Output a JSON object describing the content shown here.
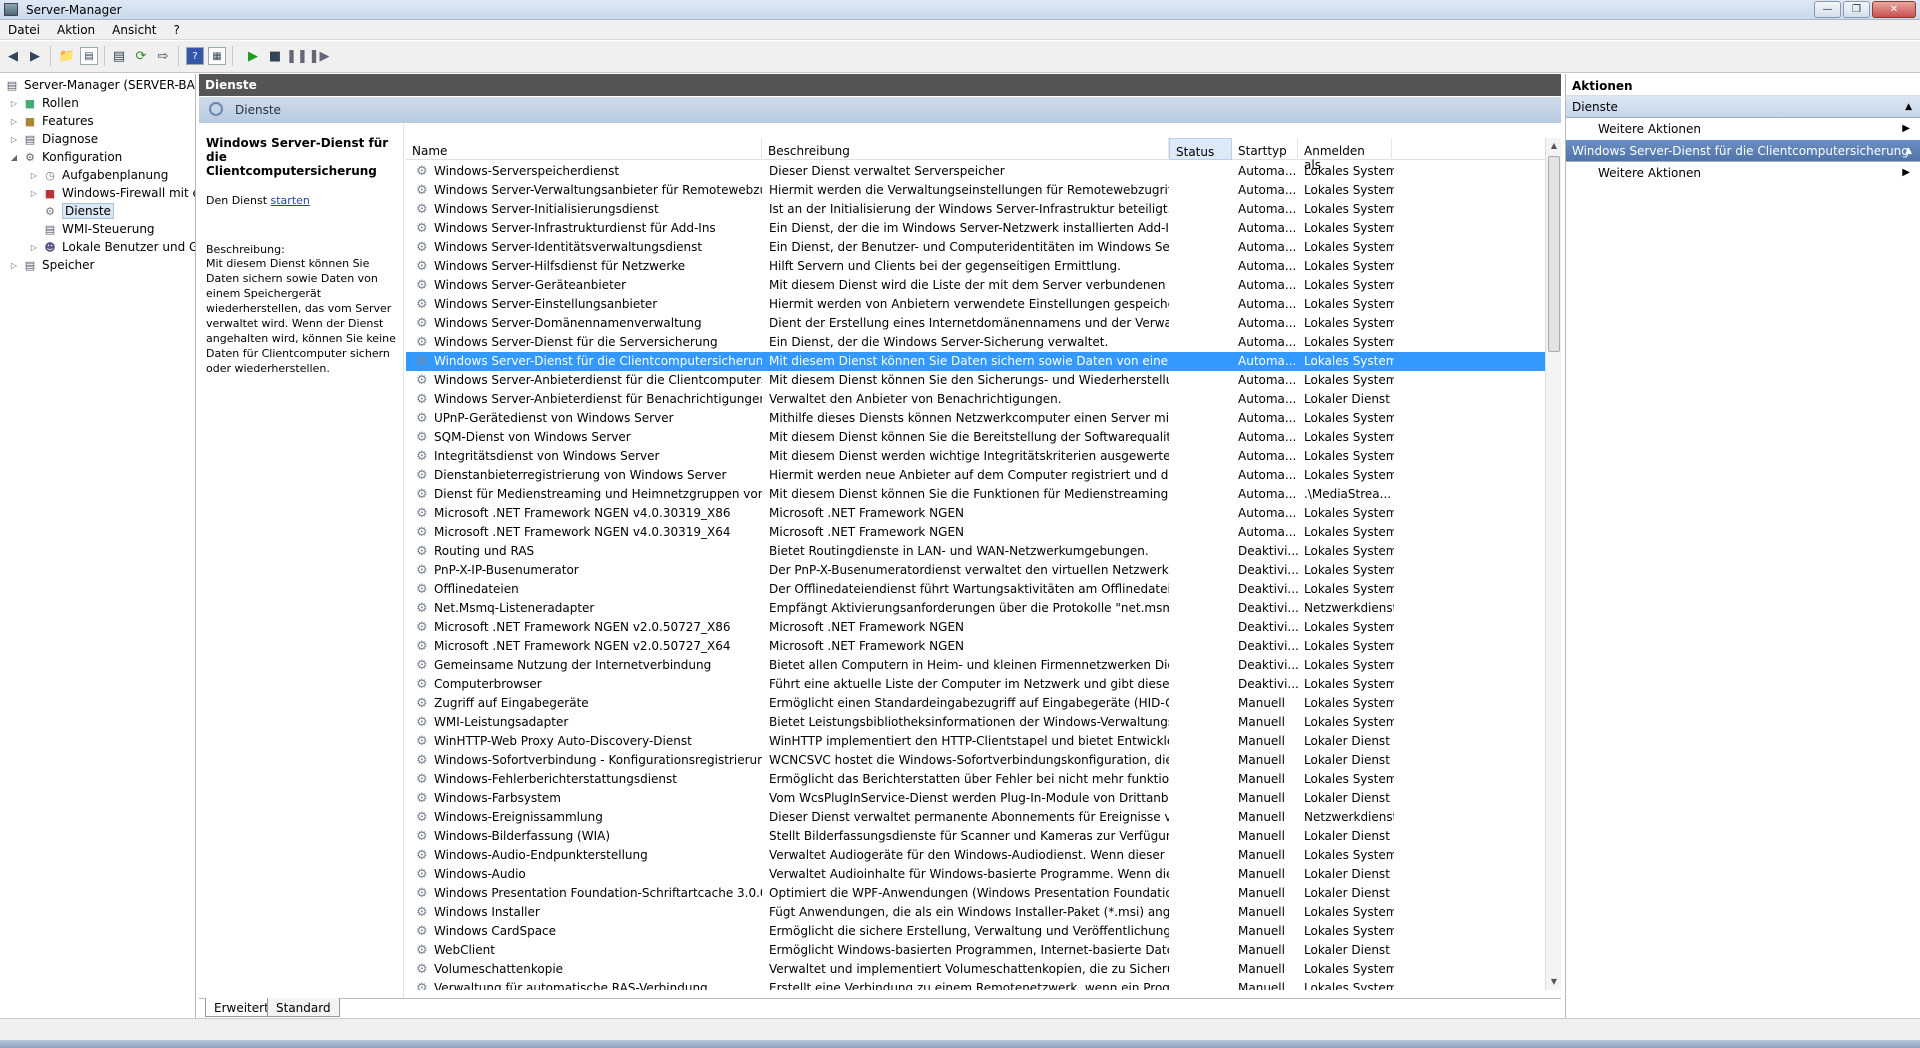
{
  "window": {
    "title": "Server-Manager"
  },
  "menu": [
    "Datei",
    "Aktion",
    "Ansicht",
    "?"
  ],
  "tree": {
    "items": [
      {
        "label": "Server-Manager (SERVER-BACKUP)",
        "level": 0,
        "expander": "",
        "icon": "server-icon"
      },
      {
        "label": "Rollen",
        "level": 1,
        "expander": "▷",
        "icon": "roles-icon"
      },
      {
        "label": "Features",
        "level": 1,
        "expander": "▷",
        "icon": "features-icon"
      },
      {
        "label": "Diagnose",
        "level": 1,
        "expander": "▷",
        "icon": "diagnostics-icon"
      },
      {
        "label": "Konfiguration",
        "level": 1,
        "expander": "◢",
        "icon": "configuration-icon"
      },
      {
        "label": "Aufgabenplanung",
        "level": 2,
        "expander": "▷",
        "icon": "clock-icon"
      },
      {
        "label": "Windows-Firewall mit erweiterter Sicherheit",
        "level": 2,
        "expander": "▷",
        "icon": "firewall-icon"
      },
      {
        "label": "Dienste",
        "level": 2,
        "expander": "",
        "icon": "services-icon",
        "selected": true
      },
      {
        "label": "WMI-Steuerung",
        "level": 2,
        "expander": "",
        "icon": "wmi-icon"
      },
      {
        "label": "Lokale Benutzer und Gruppen",
        "level": 2,
        "expander": "▷",
        "icon": "users-icon"
      },
      {
        "label": "Speicher",
        "level": 1,
        "expander": "▷",
        "icon": "storage-icon"
      }
    ]
  },
  "center": {
    "header": "Dienste",
    "search_label": "Dienste",
    "detail": {
      "service_title": "Windows Server-Dienst für die Clientcomputersicherung",
      "action_prefix": "Den Dienst",
      "action_link": "starten",
      "desc_label": "Beschreibung:",
      "desc_text": "Mit diesem Dienst können Sie Daten sichern sowie Daten von einem Speichergerät wiederherstellen, das vom Server verwaltet wird. Wenn der Dienst angehalten wird, können Sie keine Daten für Clientcomputer sichern oder wiederherstellen."
    },
    "columns": [
      "Name",
      "Beschreibung",
      "Status",
      "Starttyp",
      "Anmelden als"
    ],
    "rows": [
      [
        "Windows-Serverspeicherdienst",
        "Dieser Dienst verwaltet Serverspeicher",
        "",
        "Automa...",
        "Lokales System"
      ],
      [
        "Windows Server-Verwaltungsanbieter für Remotewebzugriff",
        "Hiermit werden die Verwaltungseinstellungen für Remotewebzugriff konfi...",
        "",
        "Automa...",
        "Lokales System"
      ],
      [
        "Windows Server-Initialisierungsdienst",
        "Ist an der Initialisierung der Windows Server-Infrastruktur beteiligt.",
        "",
        "Automa...",
        "Lokales System"
      ],
      [
        "Windows Server-Infrastrukturdienst für Add-Ins",
        "Ein Dienst, der die im Windows Server-Netzwerk installierten Add-Ins verw...",
        "",
        "Automa...",
        "Lokales System"
      ],
      [
        "Windows Server-Identitätsverwaltungsdienst",
        "Ein Dienst, der Benutzer- und Computeridentitäten im Windows Server-N...",
        "",
        "Automa...",
        "Lokales System"
      ],
      [
        "Windows Server-Hilfsdienst für Netzwerke",
        "Hilft Servern und Clients bei der gegenseitigen Ermittlung.",
        "",
        "Automa...",
        "Lokales System"
      ],
      [
        "Windows Server-Geräteanbieter",
        "Mit diesem Dienst wird die Liste der mit dem Server verbundenen Comput...",
        "",
        "Automa...",
        "Lokales System"
      ],
      [
        "Windows Server-Einstellungsanbieter",
        "Hiermit werden von Anbietern verwendete Einstellungen gespeichert.",
        "",
        "Automa...",
        "Lokales System"
      ],
      [
        "Windows Server-Domänennamenverwaltung",
        "Dient der Erstellung eines Internetdomänennamens und der Verwaltung d...",
        "",
        "Automa...",
        "Lokales System"
      ],
      [
        "Windows Server-Dienst für die Serversicherung",
        "Ein Dienst, der die Windows Server-Sicherung verwaltet.",
        "",
        "Automa...",
        "Lokales System"
      ],
      [
        "Windows Server-Dienst für die Clientcomputersicherung",
        "Mit diesem Dienst können Sie Daten sichern sowie Daten von einem Speic...",
        "",
        "Automa...",
        "Lokales System"
      ],
      [
        "Windows Server-Anbieterdienst für die Clientcomputersicher...",
        "Mit diesem Dienst können Sie den Sicherungs- und Wiederherstellungsdie...",
        "",
        "Automa...",
        "Lokales System"
      ],
      [
        "Windows Server-Anbieterdienst für Benachrichtigungen",
        "Verwaltet den Anbieter von Benachrichtigungen.",
        "",
        "Automa...",
        "Lokaler Dienst"
      ],
      [
        "UPnP-Gerätedienst von Windows Server",
        "Mithilfe dieses Diensts können Netzwerkcomputer einen Server mit Windo...",
        "",
        "Automa...",
        "Lokales System"
      ],
      [
        "SQM-Dienst von Windows Server",
        "Mit diesem Dienst können Sie die Bereitstellung der Softwarequalitätsmetr...",
        "",
        "Automa...",
        "Lokales System"
      ],
      [
        "Integritätsdienst von Windows Server",
        "Mit diesem Dienst werden wichtige Integritätskriterien ausgewertet sowie ...",
        "",
        "Automa...",
        "Lokales System"
      ],
      [
        "Dienstanbieterregistrierung von Windows Server",
        "Hiermit werden neue Anbieter auf dem Computer registriert und die Anbi...",
        "",
        "Automa...",
        "Lokales System"
      ],
      [
        "Dienst für Medienstreaming und Heimnetzgruppen von Wind...",
        "Mit diesem Dienst können Sie die Funktionen für Medienstreaming und H...",
        "",
        "Automa...",
        ".\\MediaStrea..."
      ],
      [
        "Microsoft .NET Framework NGEN v4.0.30319_X86",
        "Microsoft .NET Framework NGEN",
        "",
        "Automa...",
        "Lokales System"
      ],
      [
        "Microsoft .NET Framework NGEN v4.0.30319_X64",
        "Microsoft .NET Framework NGEN",
        "",
        "Automa...",
        "Lokales System"
      ],
      [
        "Routing und RAS",
        "Bietet Routingdienste in LAN- und WAN-Netzwerkumgebungen.",
        "",
        "Deaktivi...",
        "Lokales System"
      ],
      [
        "PnP-X-IP-Busenumerator",
        "Der PnP-X-Busenumeratordienst verwaltet den virtuellen Netzwerkbus. Er ...",
        "",
        "Deaktivi...",
        "Lokales System"
      ],
      [
        "Offlinedateien",
        "Der Offlinedateiendienst führt Wartungsaktivitäten am Offlinedateiendien...",
        "",
        "Deaktivi...",
        "Lokales System"
      ],
      [
        "Net.Msmq-Listeneradapter",
        "Empfängt Aktivierungsanforderungen über die Protokolle \"net.msmq\" un...",
        "",
        "Deaktivi...",
        "Netzwerkdienst"
      ],
      [
        "Microsoft .NET Framework NGEN v2.0.50727_X86",
        "Microsoft .NET Framework NGEN",
        "",
        "Deaktivi...",
        "Lokales System"
      ],
      [
        "Microsoft .NET Framework NGEN v2.0.50727_X64",
        "Microsoft .NET Framework NGEN",
        "",
        "Deaktivi...",
        "Lokales System"
      ],
      [
        "Gemeinsame Nutzung der Internetverbindung",
        "Bietet allen Computern in Heim- und kleinen Firmennetzwerken Dienste f...",
        "",
        "Deaktivi...",
        "Lokales System"
      ],
      [
        "Computerbrowser",
        "Führt eine aktuelle Liste der Computer im Netzwerk und gibt diese an als ...",
        "",
        "Deaktivi...",
        "Lokales System"
      ],
      [
        "Zugriff auf Eingabegeräte",
        "Ermöglicht einen Standardeingabezugriff auf Eingabegeräte (HID-Geräte), ...",
        "",
        "Manuell",
        "Lokales System"
      ],
      [
        "WMI-Leistungsadapter",
        "Bietet Leistungsbibliotheksinformationen der Windows-Verwaltungsinstru...",
        "",
        "Manuell",
        "Lokales System"
      ],
      [
        "WinHTTP-Web Proxy Auto-Discovery-Dienst",
        "WinHTTP implementiert den HTTP-Clientstapel und bietet Entwicklern ei...",
        "",
        "Manuell",
        "Lokaler Dienst"
      ],
      [
        "Windows-Sofortverbindung - Konfigurationsregistrierungsste...",
        "WCNCSVC hostet die Windows-Sofortverbindungskonfiguration, die die I...",
        "",
        "Manuell",
        "Lokaler Dienst"
      ],
      [
        "Windows-Fehlerberichterstattungsdienst",
        "Ermöglicht das Berichterstatten über Fehler bei nicht mehr funktionierend...",
        "",
        "Manuell",
        "Lokales System"
      ],
      [
        "Windows-Farbsystem",
        "Vom WcsPlugInService-Dienst werden Plug-In-Module von Drittanbietern...",
        "",
        "Manuell",
        "Lokaler Dienst"
      ],
      [
        "Windows-Ereignissammlung",
        "Dieser Dienst verwaltet permanente Abonnements für Ereignisse von Rem...",
        "",
        "Manuell",
        "Netzwerkdienst"
      ],
      [
        "Windows-Bilderfassung (WIA)",
        "Stellt Bilderfassungsdienste für Scanner und Kameras zur Verfügung",
        "",
        "Manuell",
        "Lokaler Dienst"
      ],
      [
        "Windows-Audio-Endpunkterstellung",
        "Verwaltet Audiogeräte für den Windows-Audiodienst. Wenn dieser Dienst ...",
        "",
        "Manuell",
        "Lokales System"
      ],
      [
        "Windows-Audio",
        "Verwaltet Audioinhalte für Windows-basierte Programme. Wenn dieser Di...",
        "",
        "Manuell",
        "Lokaler Dienst"
      ],
      [
        "Windows Presentation Foundation-Schriftartcache 3.0.0.0",
        "Optimiert die WPF-Anwendungen (Windows Presentation Foundation), in...",
        "",
        "Manuell",
        "Lokaler Dienst"
      ],
      [
        "Windows Installer",
        "Fügt Anwendungen, die als ein Windows Installer-Paket (*.msi) angebote...",
        "",
        "Manuell",
        "Lokales System"
      ],
      [
        "Windows CardSpace",
        "Ermöglicht die sichere Erstellung, Verwaltung und Veröffentlichung digital...",
        "",
        "Manuell",
        "Lokales System"
      ],
      [
        "WebClient",
        "Ermöglicht Windows-basierten Programmen, Internet-basierte Dateien zu ...",
        "",
        "Manuell",
        "Lokaler Dienst"
      ],
      [
        "Volumeschattenkopie",
        "Verwaltet und implementiert Volumeschattenkopien, die zu Sicherungs- u...",
        "",
        "Manuell",
        "Lokales System"
      ],
      [
        "Verwaltung für automatische RAS-Verbindung",
        "Erstellt eine Verbindung zu einem Remotenetzwerk, wenn ein Programm e...",
        "",
        "Manuell",
        "Lokales System"
      ]
    ],
    "selected_row": 10,
    "tabs": [
      "Erweitert",
      "Standard"
    ]
  },
  "actions": {
    "header": "Aktionen",
    "sections": [
      {
        "title": "Dienste",
        "items": [
          "Weitere Aktionen"
        ]
      },
      {
        "title": "Windows Server-Dienst für die Clientcomputersicherung",
        "items": [
          "Weitere Aktionen"
        ]
      }
    ]
  },
  "colors": {
    "selection": "#3399ff",
    "header_bar": "#555555",
    "link": "#2245a0"
  }
}
